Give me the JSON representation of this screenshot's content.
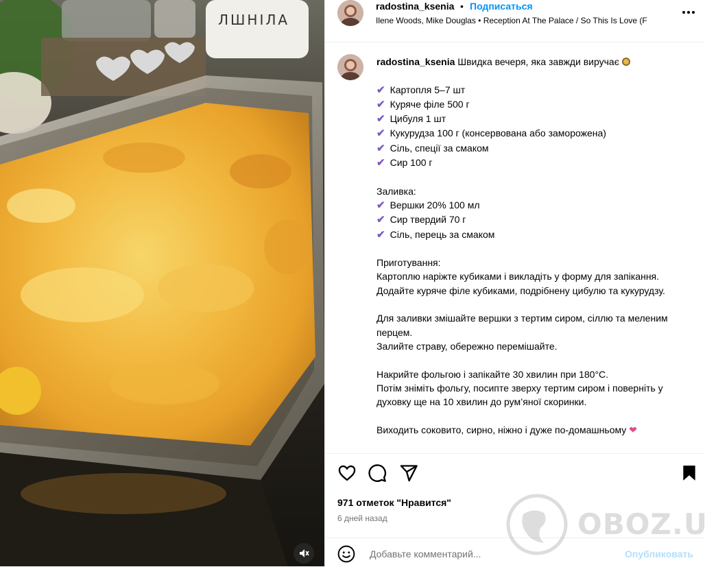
{
  "header": {
    "username": "radostina_ksenia",
    "dot": "•",
    "follow_label": "Подписаться",
    "audio": "Ilene Woods, Mike Douglas • Reception At The Palace / So This Is Love (F"
  },
  "caption": {
    "username": "radostina_ksenia",
    "intro": "Швидка вечеря, яка завжди виручає",
    "check_symbol": "✔",
    "ingredients": [
      "Картопля 5–7 шт",
      "Куряче філе 500 г",
      "Цибуля 1 шт",
      "Кукурудза 100 г (консервована або заморожена)",
      "Сіль, спеції за смаком",
      "Сир 100 г"
    ],
    "filling_title": "Заливка:",
    "filling": [
      "Вершки 20% 100 мл",
      "Сир твердий 70 г",
      "Сіль, перець за смаком"
    ],
    "prep_lines": [
      "Приготування:",
      "Картоплю наріжте кубиками і викладіть у форму для запікання.",
      "Додайте куряче філе кубиками, подрібнену цибулю та кукурудзу."
    ],
    "sauce_lines": [
      "Для заливки змішайте вершки з тертим сиром, сіллю та меленим перцем.",
      "Залийте страву, обережно перемішайте."
    ],
    "bake_lines": [
      "Накрийте фольгою і запікайте 30 хвилин при 180°C.",
      "Потім зніміть фольгу, посипте зверху тертим сиром і поверніть у духовку ще на 10 хвилин до рум’яної скоринки."
    ],
    "final_line": "Виходить соковито, сирно, ніжно і дуже по-домашньому",
    "final_emoji": "❤"
  },
  "actions": {
    "likes": "971 отметок \"Нравится\"",
    "time": "6 дней назад",
    "comment_placeholder": "Добавьте комментарий...",
    "post_label": "Опубликовать"
  },
  "media": {
    "jar_text": "ЛШНІЛА"
  },
  "watermark": {
    "text": "OBOZ.UA"
  },
  "colors": {
    "accent": "#0095f6",
    "check": "#7b5cc4",
    "post_disabled": "#b2dffc",
    "secondary_text": "#737373"
  }
}
